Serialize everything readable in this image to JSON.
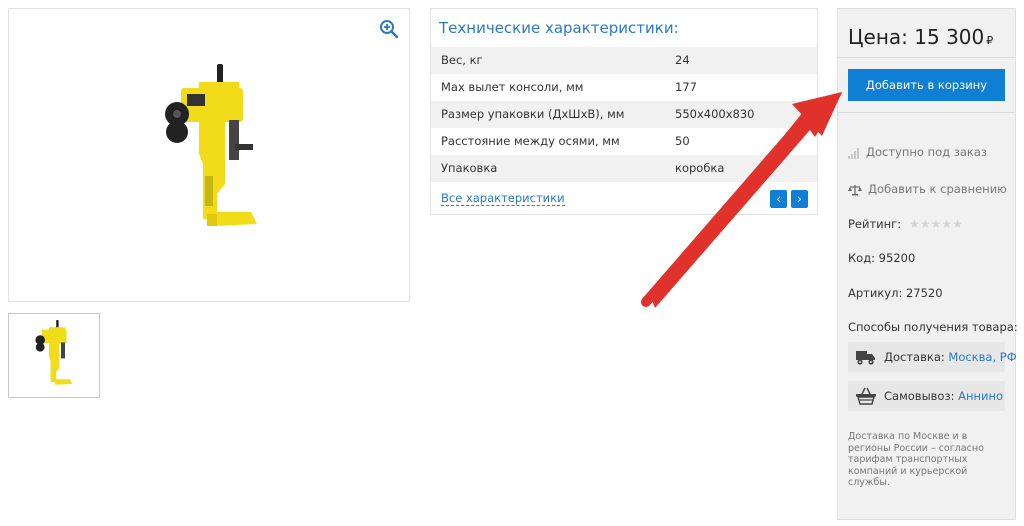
{
  "specs": {
    "title": "Технические характеристики:",
    "rows": [
      {
        "name": "Вес, кг",
        "value": "24"
      },
      {
        "name": "Max вылет консоли, мм",
        "value": "177"
      },
      {
        "name": "Размер упаковки (ДxШxВ), мм",
        "value": "550x400x830"
      },
      {
        "name": "Расстояние между осями, мм",
        "value": "50"
      },
      {
        "name": "Упаковка",
        "value": "коробка"
      }
    ],
    "all_link": "Все характеристики",
    "prev_label": "‹",
    "next_label": "›"
  },
  "sidebar": {
    "price_label": "Цена: 15 300",
    "currency": "₽",
    "cart_button": "Добавить в корзину",
    "availability": "Доступно под заказ",
    "compare": "Добавить к сравнению",
    "rating_label": "Рейтинг:",
    "rating_stars": "★★★★★",
    "code": "Код: 95200",
    "article": "Артикул: 27520",
    "delivery_methods_title": "Способы получения товара:",
    "delivery_label": "Доставка:",
    "delivery_link": "Москва, РФ",
    "pickup_label": "Самовывоз:",
    "pickup_link": "Аннино",
    "note": "Доставка по Москве и в регионы России – согласно тарифам транспортных компаний и курьерской службы."
  },
  "colors": {
    "accent": "#0f7fd6",
    "link": "#2a7ac8",
    "arrow": "#e0322a",
    "product_yellow": "#f2dc1a"
  },
  "icons": [
    "zoom-in-icon",
    "signal-bars-icon",
    "scales-icon",
    "star-icon",
    "truck-icon",
    "basket-icon",
    "chevron-left-icon",
    "chevron-right-icon"
  ]
}
